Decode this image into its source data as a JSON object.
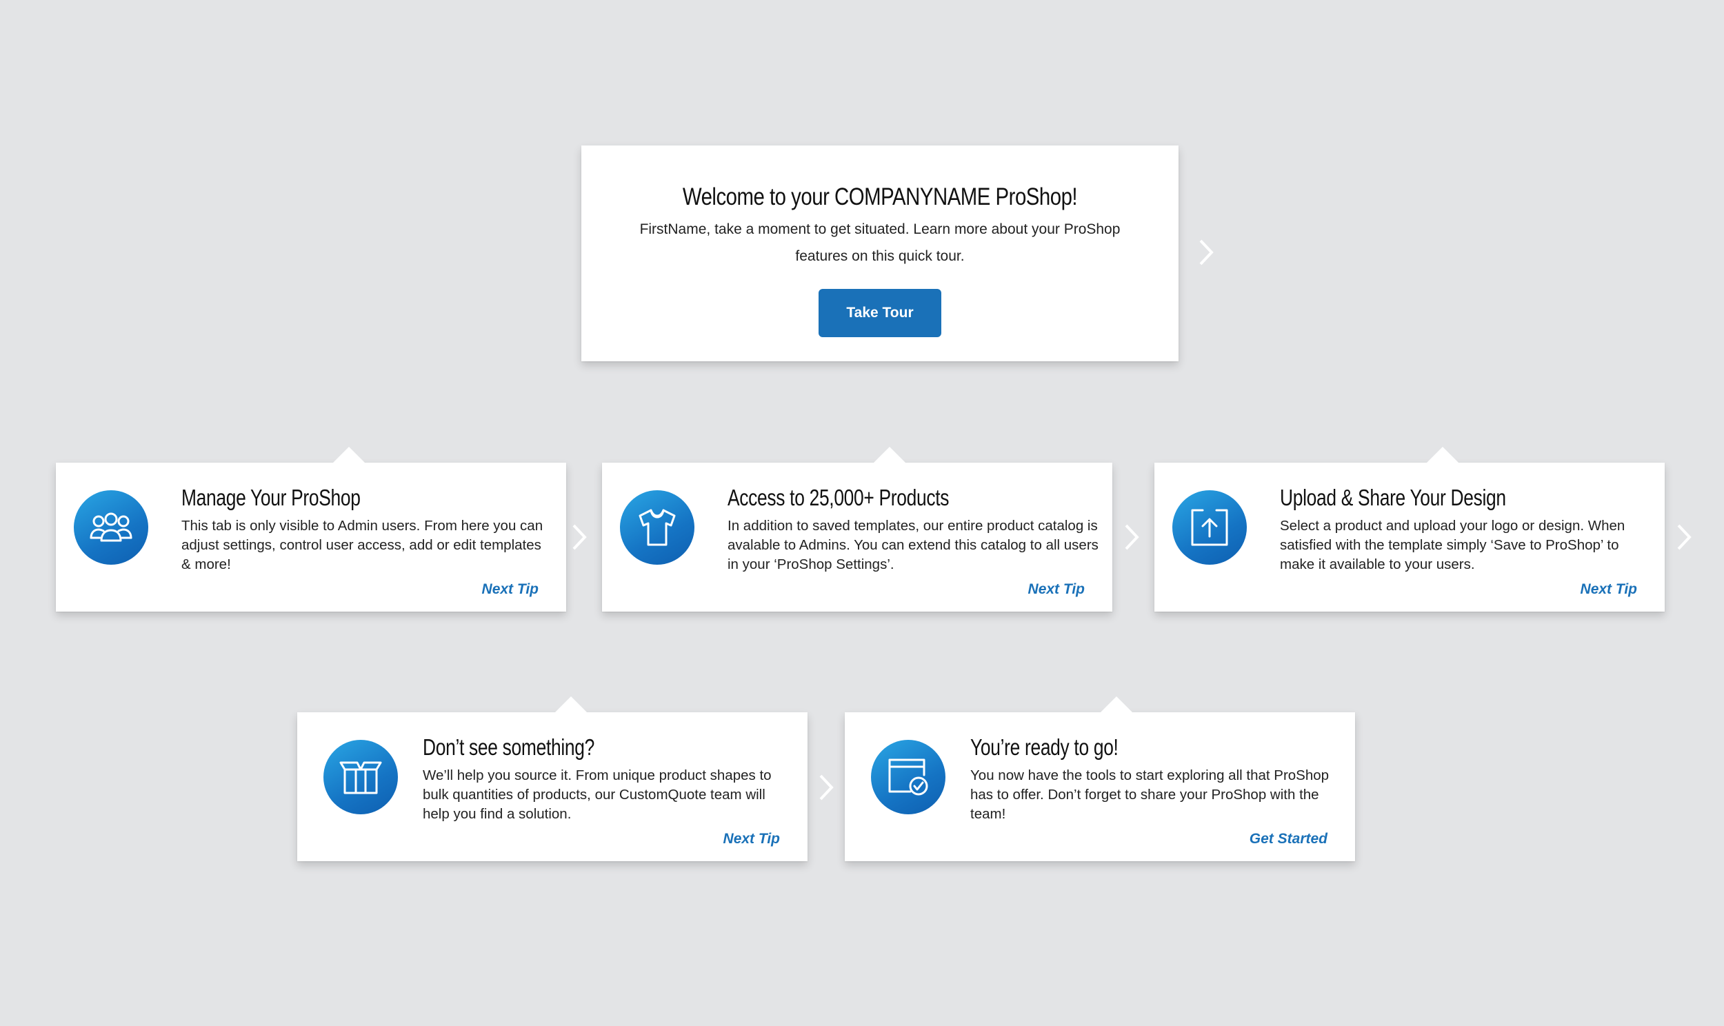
{
  "welcome": {
    "title": "Welcome to your COMPANYNAME ProShop!",
    "body": "FirstName, take a moment to get situated. Learn more about your ProShop features on this quick tour.",
    "button_label": "Take Tour"
  },
  "tips": [
    {
      "title": "Manage Your ProShop",
      "body": "This tab is only visible to Admin users. From here you can adjust settings, control user access, add or edit templates & more!",
      "link": "Next Tip",
      "icon": "users-icon"
    },
    {
      "title": "Access to 25,000+ Products",
      "body": "In addition to saved templates, our entire product catalog is avalable to Admins. You can extend this catalog to all users in your ‘ProShop Settings’.",
      "link": "Next Tip",
      "icon": "tshirt-icon"
    },
    {
      "title": "Upload & Share Your Design",
      "body": "Select a product and upload your logo or design. When satisfied with the template simply ‘Save to ProShop’ to make it available to your users.",
      "link": "Next Tip",
      "icon": "upload-icon"
    },
    {
      "title": "Don’t see something?",
      "body": "We’ll help you source it. From unique product shapes to bulk quantities of products, our CustomQuote team will help you find a solution.",
      "link": "Next Tip",
      "icon": "box-icon"
    },
    {
      "title": "You’re ready to go!",
      "body": "You now have the tools to start exploring all that ProShop has to offer. Don’t forget to share your ProShop with the team!",
      "link": "Get Started",
      "icon": "window-check-icon"
    }
  ],
  "colors": {
    "background": "#e3e4e6",
    "accent": "#1a71b8",
    "icon_gradient_start": "#2aa6e4",
    "icon_gradient_end": "#0e5fb0"
  }
}
